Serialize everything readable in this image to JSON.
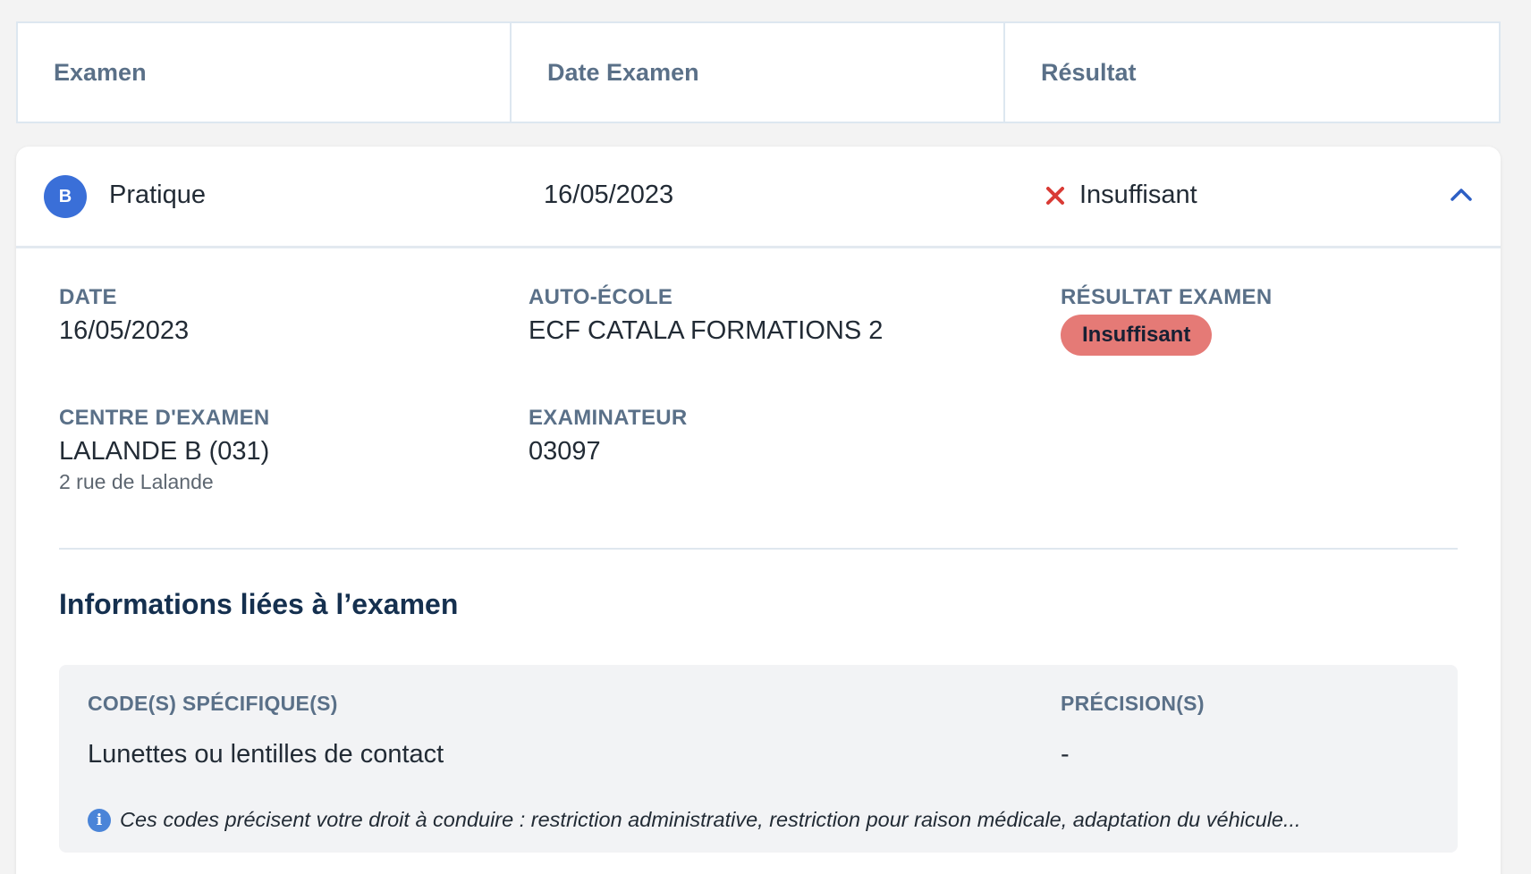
{
  "table_header": {
    "col_exam": "Examen",
    "col_date": "Date Examen",
    "col_result": "Résultat"
  },
  "row": {
    "category_badge": "B",
    "exam_type": "Pratique",
    "date": "16/05/2023",
    "result_icon": "x-icon",
    "result": "Insuffisant",
    "toggle_icon": "chevron-up-icon"
  },
  "details": {
    "date_label": "DATE",
    "date_value": "16/05/2023",
    "school_label": "AUTO-ÉCOLE",
    "school_value": "ECF CATALA FORMATIONS 2",
    "result_label": "RÉSULTAT EXAMEN",
    "result_badge": "Insuffisant",
    "result_badge_color": "#e57a76",
    "center_label": "CENTRE D'EXAMEN",
    "center_value": "LALANDE B (031)",
    "center_address": "2 rue de Lalande",
    "examiner_label": "EXAMINATEUR",
    "examiner_value": "03097"
  },
  "info_section": {
    "title": "Informations liées à l’examen",
    "codes_label": "CODE(S) SPÉCIFIQUE(S)",
    "precision_label": "PRÉCISION(S)",
    "code_value": "Lunettes ou lentilles de contact",
    "precision_value": "-",
    "note_icon": "info-icon",
    "note": "Ces codes précisent votre droit à conduire : restriction administrative, restriction pour raison médicale, adaptation du véhicule..."
  },
  "colors": {
    "badge_blue": "#3a6fd8",
    "error_red": "#d93b35",
    "label_grey": "#5a7088",
    "title_navy": "#15304f"
  }
}
